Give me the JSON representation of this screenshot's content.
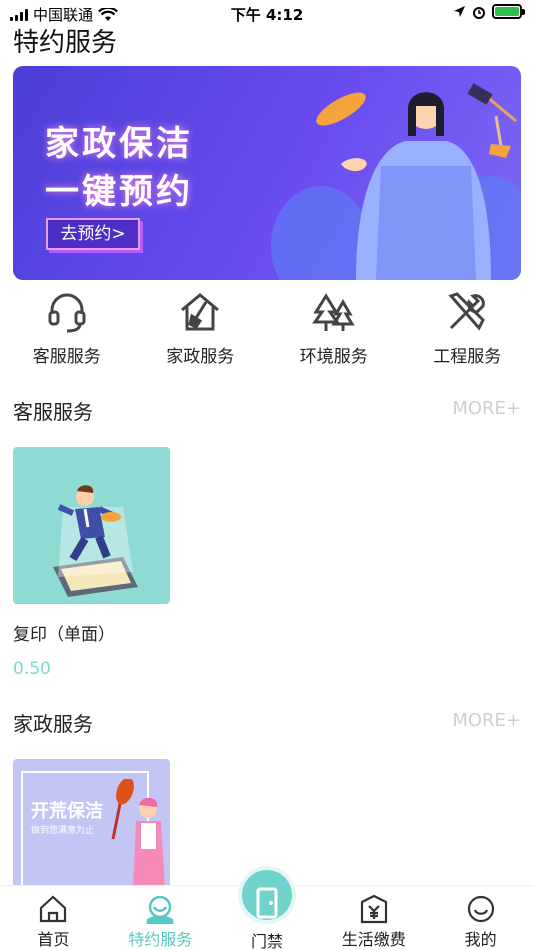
{
  "status_bar": {
    "carrier": "中国联通",
    "time": "下午 4:12"
  },
  "page_title": "特约服务",
  "banner": {
    "line1": "家政保洁",
    "line2": "一键预约",
    "button": "去预约>",
    "colors": {
      "bg_start": "#4a3fd6",
      "bg_end": "#7c6af5"
    }
  },
  "categories": [
    {
      "label": "客服服务",
      "icon": "headset-icon"
    },
    {
      "label": "家政服务",
      "icon": "house-broom-icon"
    },
    {
      "label": "环境服务",
      "icon": "trees-icon"
    },
    {
      "label": "工程服务",
      "icon": "tools-icon"
    }
  ],
  "sections": [
    {
      "title": "客服服务",
      "more": "MORE+",
      "products": [
        {
          "name": "复印（单面）",
          "price": "0.50"
        }
      ]
    },
    {
      "title": "家政服务",
      "more": "MORE+",
      "products": [
        {
          "image_text": "开荒保洁",
          "image_subtext": "做到您满意为止"
        }
      ]
    }
  ],
  "tab_bar": [
    {
      "label": "首页",
      "icon": "home-icon"
    },
    {
      "label": "特约服务",
      "icon": "service-icon",
      "active": true
    },
    {
      "label": "门禁",
      "icon": "door-icon"
    },
    {
      "label": "生活缴费",
      "icon": "payment-icon"
    },
    {
      "label": "我的",
      "icon": "smiley-icon"
    }
  ],
  "colors": {
    "accent": "#57c9c3",
    "more": "#cfcfcf"
  }
}
